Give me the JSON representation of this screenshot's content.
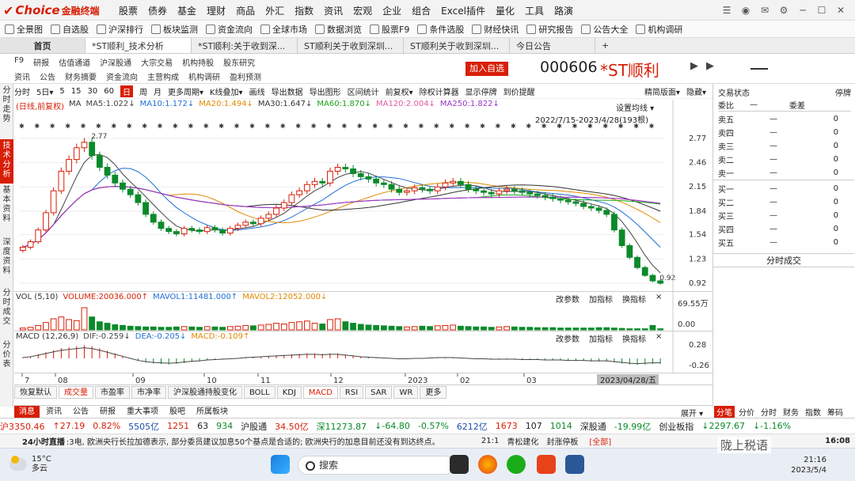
{
  "app": {
    "brand": "Choice",
    "brand_cn": "金融终端"
  },
  "menu": [
    "股票",
    "债券",
    "基金",
    "理财",
    "商品",
    "外汇",
    "指数",
    "资讯",
    "宏观",
    "企业",
    "组合",
    "Excel插件",
    "量化",
    "工具",
    "路演"
  ],
  "toolbar": [
    "全景图",
    "自选股",
    "沪深排行",
    "板块监测",
    "资金流向",
    "全球市场",
    "数据浏览",
    "股票F9",
    "条件选股",
    "财经快讯",
    "研究报告",
    "公告大全",
    "机构调研"
  ],
  "tabs": {
    "home": "首页",
    "items": [
      "*ST顺利_技术分析",
      "*ST顺利:关于收到深...",
      "ST顺利关于收到深圳...",
      "ST顺利关于收到深圳...",
      "今日公告"
    ],
    "add": "+"
  },
  "f10": {
    "row1": [
      "F9",
      "研报",
      "估值通道",
      "沪深股通",
      "大宗交易",
      "机构持股",
      "股东研究"
    ],
    "row2": [
      "资讯",
      "公告",
      "财务摘要",
      "资金流向",
      "主营构成",
      "机构调研",
      "盈利预测"
    ]
  },
  "stock": {
    "add_label": "加入自选",
    "code": "000606",
    "name": "*ST顺利"
  },
  "leftnav": [
    "分时走势",
    "技术分析",
    "基本资料",
    "深度资料",
    "分时成交",
    "分价表"
  ],
  "periods": [
    "分时",
    "5日▾",
    "5",
    "15",
    "30",
    "60",
    "日",
    "周",
    "月",
    "更多周期▾"
  ],
  "period_selected": "日",
  "chart_tools": [
    "K线叠加▾",
    "画线",
    "导出数据",
    "导出图形",
    "区间统计",
    "前复权▾",
    "除权计算器",
    "显示停牌",
    "到价提醒",
    "精简版面▾",
    "隐藏▾"
  ],
  "ma_legend": [
    {
      "t": "(日线,前复权)",
      "c": "#d81e06"
    },
    {
      "t": "MA",
      "c": "#333333"
    },
    {
      "t": "MA5:1.022↓",
      "c": "#444444"
    },
    {
      "t": "MA10:1.172↓",
      "c": "#1f6fd6"
    },
    {
      "t": "MA20:1.494↓",
      "c": "#e08a00"
    },
    {
      "t": "MA30:1.647↓",
      "c": "#333333"
    },
    {
      "t": "MA60:1.870↓",
      "c": "#1aa31a"
    },
    {
      "t": "MA120:2.004↓",
      "c": "#e05aa0"
    },
    {
      "t": "MA250:1.822↓",
      "c": "#9932cc"
    }
  ],
  "set_avg": "设置均线 ▾",
  "date_range": "2022/7/15-2023/4/28(193根)",
  "vol_legend": [
    {
      "t": "VOL (5,10)",
      "c": "#333333"
    },
    {
      "t": "VOLUME:20036.000↑",
      "c": "#d81e06"
    },
    {
      "t": "MAVOL1:11481.000↑",
      "c": "#1f6fd6"
    },
    {
      "t": "MAVOL2:12052.000↓",
      "c": "#e08a00"
    }
  ],
  "macd_legend": [
    {
      "t": "MACD (12,26,9)",
      "c": "#333333"
    },
    {
      "t": "DIF:-0.259↓",
      "c": "#444444"
    },
    {
      "t": "DEA:-0.205↓",
      "c": "#1f6fd6"
    },
    {
      "t": "MACD:-0.109↑",
      "c": "#e08a00"
    }
  ],
  "sub_tools": [
    "改参数",
    "加指标",
    "换指标"
  ],
  "chart_data": [
    {
      "type": "candlestick",
      "title": "",
      "ylim": [
        0.92,
        2.9
      ],
      "y_ticks": [
        2.77,
        2.46,
        2.15,
        1.84,
        1.54,
        1.23,
        0.92
      ],
      "annotations": [
        {
          "label": "2.77",
          "y": 2.77
        },
        {
          "label": "0.92",
          "y": 0.92
        }
      ],
      "close": [
        1.38,
        1.45,
        1.6,
        1.82,
        2.1,
        2.35,
        2.5,
        2.65,
        2.72,
        2.55,
        2.4,
        2.3,
        2.2,
        2.12,
        2.05,
        1.95,
        1.8,
        1.7,
        1.62,
        1.58,
        1.55,
        1.62,
        1.6,
        1.58,
        1.63,
        1.6,
        1.56,
        1.62,
        1.66,
        1.7,
        1.68,
        1.75,
        1.8,
        1.88,
        1.95,
        2.05,
        2.1,
        2.18,
        2.22,
        2.2,
        2.35,
        2.4,
        2.38,
        2.32,
        2.28,
        2.25,
        2.2,
        2.18,
        2.12,
        2.08,
        2.1,
        2.14,
        2.12,
        2.1,
        2.15,
        2.2,
        2.22,
        2.18,
        2.12,
        2.1,
        2.08,
        2.06,
        2.1,
        2.12,
        2.1,
        2.08,
        2.06,
        2.04,
        2.02,
        2.0,
        1.98,
        1.96,
        1.94,
        1.9,
        1.88,
        1.85,
        1.8,
        1.6,
        1.4,
        1.25,
        1.12,
        1.02,
        0.95,
        0.92
      ],
      "ma_series": [
        {
          "name": "MA5",
          "color": "#444444"
        },
        {
          "name": "MA10",
          "color": "#1f6fd6"
        },
        {
          "name": "MA20",
          "color": "#e08a00"
        },
        {
          "name": "MA30",
          "color": "#333333"
        },
        {
          "name": "MA60",
          "color": "#1aa31a"
        },
        {
          "name": "MA120",
          "color": "#e05aa0"
        },
        {
          "name": "MA250",
          "color": "#9932cc"
        }
      ]
    },
    {
      "type": "bar",
      "title": "VOL",
      "y_ticks_labels": [
        "69.55万",
        "0.00"
      ],
      "values": [
        5,
        7,
        12,
        20,
        30,
        35,
        28,
        25,
        60,
        35,
        22,
        18,
        14,
        12,
        10,
        9,
        8,
        8,
        7,
        7,
        8,
        9,
        8,
        7,
        9,
        8,
        7,
        9,
        10,
        12,
        11,
        13,
        15,
        18,
        16,
        20,
        22,
        24,
        18,
        16,
        28,
        30,
        22,
        18,
        15,
        13,
        12,
        11,
        10,
        9,
        8,
        9,
        10,
        9,
        11,
        12,
        13,
        10,
        9,
        8,
        8,
        7,
        8,
        9,
        8,
        7,
        7,
        6,
        6,
        6,
        5,
        5,
        5,
        5,
        5,
        6,
        6,
        5,
        4,
        3,
        3,
        3,
        12,
        3
      ]
    },
    {
      "type": "bar",
      "title": "MACD",
      "y_ticks": [
        0.28,
        -0.26
      ],
      "values": [
        0.02,
        0.04,
        0.08,
        0.12,
        0.16,
        0.2,
        0.22,
        0.24,
        0.26,
        0.24,
        0.2,
        0.15,
        0.1,
        0.05,
        0.0,
        -0.05,
        -0.08,
        -0.1,
        -0.11,
        -0.12,
        -0.11,
        -0.09,
        -0.07,
        -0.06,
        -0.04,
        -0.03,
        -0.02,
        -0.01,
        0.0,
        0.02,
        0.03,
        0.04,
        0.05,
        0.06,
        0.07,
        0.08,
        0.09,
        0.1,
        0.1,
        0.09,
        0.1,
        0.1,
        0.08,
        0.06,
        0.04,
        0.03,
        0.02,
        0.01,
        0.0,
        -0.01,
        -0.01,
        0.0,
        0.0,
        0.01,
        0.02,
        0.02,
        0.02,
        0.01,
        0.0,
        -0.01,
        -0.01,
        -0.02,
        -0.02,
        -0.02,
        -0.02,
        -0.03,
        -0.03,
        -0.03,
        -0.04,
        -0.04,
        -0.04,
        -0.05,
        -0.05,
        -0.05,
        -0.06,
        -0.06,
        -0.06,
        -0.08,
        -0.1,
        -0.12,
        -0.13,
        -0.12,
        -0.11,
        -0.11
      ]
    }
  ],
  "xaxis": [
    "7",
    "08",
    "09",
    "10",
    "11",
    "12",
    "2023",
    "02",
    "03"
  ],
  "xaxis_end": "2023/04/28/五",
  "indicator_tabs": [
    "恢复默认",
    "成交量",
    "市盈率",
    "市净率",
    "沪深股通持股变化",
    "BOLL",
    "KDJ",
    "MACD",
    "RSI",
    "SAR",
    "WR",
    "更多"
  ],
  "indicator_selected": "MACD",
  "news_tabs": [
    "消息",
    "资讯",
    "公告",
    "研报",
    "重大事项",
    "股吧",
    "所属板块"
  ],
  "expand": "展开 ▾",
  "right": {
    "header": "交易状态",
    "status": "停牌",
    "webi": "委比",
    "webi_v": "—",
    "wecha": "委差",
    "sell": [
      {
        "n": "卖五",
        "p": "—",
        "v": "0"
      },
      {
        "n": "卖四",
        "p": "—",
        "v": "0"
      },
      {
        "n": "卖三",
        "p": "—",
        "v": "0"
      },
      {
        "n": "卖二",
        "p": "—",
        "v": "0"
      },
      {
        "n": "卖一",
        "p": "—",
        "v": "0"
      }
    ],
    "buy": [
      {
        "n": "买一",
        "p": "—",
        "v": "0"
      },
      {
        "n": "买二",
        "p": "—",
        "v": "0"
      },
      {
        "n": "买三",
        "p": "—",
        "v": "0"
      },
      {
        "n": "买四",
        "p": "—",
        "v": "0"
      },
      {
        "n": "买五",
        "p": "—",
        "v": "0"
      }
    ],
    "ticks_title": "分时成交",
    "tabs": [
      "分笔",
      "分价",
      "分时",
      "财务",
      "指数",
      "筹码"
    ]
  },
  "status": {
    "sh": "沪3350.46",
    "sh_chg": "↑27.19",
    "sh_pct": "0.82%",
    "sh_amt": "5505亿",
    "sh_up": "1251",
    "sh_flat": "63",
    "sh_down": "934",
    "hgt": "沪股通",
    "hgt_v": "34.50亿",
    "sz": "深11273.87",
    "sz_chg": "↓-64.80",
    "sz_pct": "-0.57%",
    "sz_amt": "6212亿",
    "sz_up": "1673",
    "sz_flat": "107",
    "sz_down": "1014",
    "sgt": "深股通",
    "sgt_v": "-19.99亿",
    "cyb": "创业板指",
    "cyb_v": "↓2297.67",
    "cyb_pct": "↓-1.16%"
  },
  "news": {
    "label": "24小时直播",
    "text": ":3电, 欧洲央行长拉加德表示, 部分委员建议加息50个基点是合适的; 欧洲央行的加息目前还没有到达终点。",
    "time": "21:1",
    "source": "青松建化",
    "event": "封涨停板",
    "tag": "[全部]",
    "clock": "16:08"
  },
  "taskbar": {
    "temp": "15°C",
    "weather": "多云",
    "search": "搜索",
    "time": "21:16",
    "date": "2023/5/4"
  },
  "watermark": "陇上税语"
}
